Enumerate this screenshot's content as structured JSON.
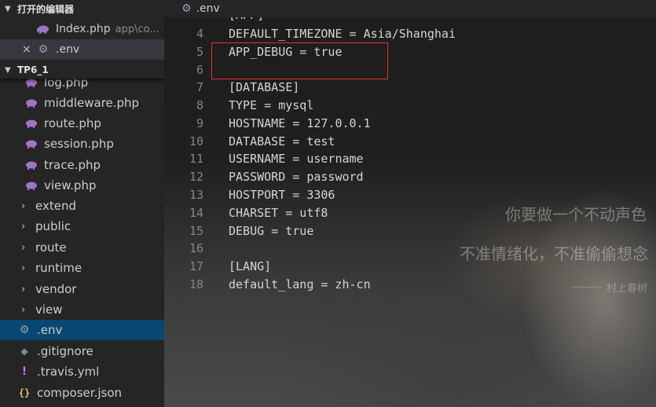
{
  "sidebar": {
    "open_editors": {
      "title": "打开的编辑器",
      "items": [
        {
          "name": "Index.php",
          "path": "app\\co..."
        },
        {
          "close": "×",
          "name": ".env"
        }
      ]
    },
    "project": {
      "title": "TP6_1",
      "items": [
        {
          "label": "log.php",
          "type": "php"
        },
        {
          "label": "middleware.php",
          "type": "php"
        },
        {
          "label": "route.php",
          "type": "php"
        },
        {
          "label": "session.php",
          "type": "php"
        },
        {
          "label": "trace.php",
          "type": "php"
        },
        {
          "label": "view.php",
          "type": "php"
        },
        {
          "label": "extend",
          "type": "folder"
        },
        {
          "label": "public",
          "type": "folder"
        },
        {
          "label": "route",
          "type": "folder"
        },
        {
          "label": "runtime",
          "type": "folder"
        },
        {
          "label": "vendor",
          "type": "folder"
        },
        {
          "label": "view",
          "type": "folder"
        },
        {
          "label": ".env",
          "type": "env",
          "selected": true
        },
        {
          "label": ".gitignore",
          "type": "git"
        },
        {
          "label": ".travis.yml",
          "type": "yml"
        },
        {
          "label": "composer.json",
          "type": "json"
        }
      ]
    }
  },
  "editor": {
    "tab": ".env",
    "partial_line": "[APP]",
    "lines": [
      {
        "n": "4",
        "code": "DEFAULT_TIMEZONE = Asia/Shanghai"
      },
      {
        "n": "5",
        "code": "APP_DEBUG = true"
      },
      {
        "n": "6",
        "code": ""
      },
      {
        "n": "7",
        "code": "[DATABASE]"
      },
      {
        "n": "8",
        "code": "TYPE = mysql"
      },
      {
        "n": "9",
        "code": "HOSTNAME = 127.0.0.1"
      },
      {
        "n": "10",
        "code": "DATABASE = test"
      },
      {
        "n": "11",
        "code": "USERNAME = username"
      },
      {
        "n": "12",
        "code": "PASSWORD = password"
      },
      {
        "n": "13",
        "code": "HOSTPORT = 3306"
      },
      {
        "n": "14",
        "code": "CHARSET = utf8"
      },
      {
        "n": "15",
        "code": "DEBUG = true"
      },
      {
        "n": "16",
        "code": ""
      },
      {
        "n": "17",
        "code": "[LANG]"
      },
      {
        "n": "18",
        "code": "default_lang = zh-cn"
      }
    ]
  },
  "overlay": {
    "quote_line1": "你要做一个不动声色",
    "quote_line2": "不准情绪化，不准偷偷想念",
    "attribution": "村上春树"
  },
  "colors": {
    "sidebar_bg": "#252526",
    "editor_bg": "#1e1e1e",
    "selection": "#094771",
    "highlight_border": "#e03131",
    "php_icon": "#a074c4"
  }
}
